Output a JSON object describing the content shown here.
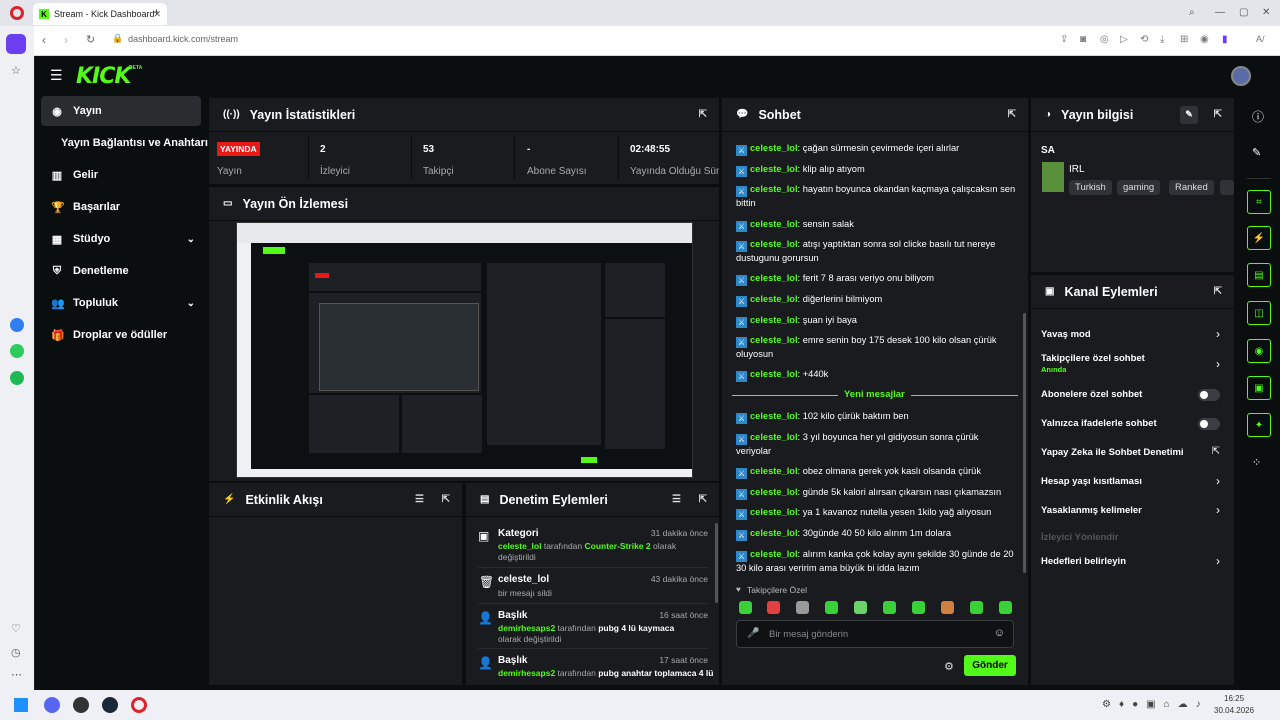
{
  "browser": {
    "tab_title": "Stream - Kick Dashboard",
    "url": "dashboard.kick.com/stream",
    "new_tab": "+"
  },
  "kick": {
    "logo": "KICK",
    "beta": "BETA",
    "accent": "#53fc18"
  },
  "sidebar": {
    "items": [
      {
        "icon": "broadcast-icon",
        "label": "Yayın"
      },
      {
        "icon": "",
        "label": "Yayın Bağlantısı ve Anahtarı"
      },
      {
        "icon": "chart-icon",
        "label": "Gelir"
      },
      {
        "icon": "trophy-icon",
        "label": "Başarılar"
      },
      {
        "icon": "grid-icon",
        "label": "Stüdyo"
      },
      {
        "icon": "shield-icon",
        "label": "Denetleme"
      },
      {
        "icon": "users-icon",
        "label": "Topluluk"
      },
      {
        "icon": "gift-icon",
        "label": "Droplar ve ödüller"
      }
    ]
  },
  "stats": {
    "title": "Yayın İstatistikleri",
    "live_badge": "YAYINDA",
    "live_label": "Yayın",
    "viewers_value": "2",
    "viewers_label": "İzleyici",
    "followers_value": "53",
    "followers_label": "Takipçi",
    "subs_value": "-",
    "subs_label": "Abone Sayısı",
    "uptime_value": "02:48:55",
    "uptime_label": "Yayında Olduğu Süre"
  },
  "preview": {
    "title": "Yayın Ön İzlemesi"
  },
  "activity": {
    "title": "Etkinlik Akışı"
  },
  "modactions": {
    "title": "Denetim Eylemleri",
    "items": [
      {
        "title": "Kategori",
        "time": "31 dakika önce",
        "user": "celeste_lol",
        "by": " tarafından ",
        "target": "Counter-Strike 2",
        "rest": " olarak değiştirildi"
      },
      {
        "title": "celeste_lol",
        "time": "43 dakika önce",
        "line": "bir mesajı sildi"
      },
      {
        "title": "Başlık",
        "time": "16 saat önce",
        "user": "demirhesaps2",
        "by": " tarafından ",
        "target": "pubg 4 lü kaymaca",
        "rest": " olarak değiştirildi"
      },
      {
        "title": "Başlık",
        "time": "17 saat önce",
        "user": "demirhesaps2",
        "by": " tarafından ",
        "target": "pubg anahtar toplamaca 4 lü"
      }
    ]
  },
  "chat": {
    "title": "Sohbet",
    "messages": [
      {
        "user": "celeste_lol",
        "text": ": çağan sürmesin çevirmede içeri alırlar"
      },
      {
        "user": "celeste_lol",
        "text": ": klip alıp atıyom"
      },
      {
        "user": "celeste_lol",
        "text": ": hayatın boyunca okandan kaçmaya çalışcaksın sen bittin"
      },
      {
        "user": "celeste_lol",
        "text": ": sensin salak"
      },
      {
        "user": "celeste_lol",
        "text": ": atışı yaptıktan sonra sol clicke basılı tut nereye dustugunu gorursun"
      },
      {
        "user": "celeste_lol",
        "text": ": ferit 7 8 arası veriyo onu biliyom"
      },
      {
        "user": "celeste_lol",
        "text": ": diğerlerini bilmiyom"
      },
      {
        "user": "celeste_lol",
        "text": ": şuan iyi baya"
      },
      {
        "user": "celeste_lol",
        "text": ": emre senin boy 175 desek 100 kilo olsan çürük oluyosun"
      },
      {
        "user": "celeste_lol",
        "text": ": +440k"
      },
      {
        "user": "celeste_lol",
        "text": ": 102 kilo çürük baktım ben"
      },
      {
        "user": "celeste_lol",
        "text": ": 3 yıl boyunca her yıl gidiyosun sonra çürük veriyolar"
      },
      {
        "user": "celeste_lol",
        "text": ": obez olmana gerek yok kaslı olsanda çürük"
      },
      {
        "user": "celeste_lol",
        "text": ": günde 5k kalori alırsan çıkarsın nası çıkamazsın"
      },
      {
        "user": "celeste_lol",
        "text": ": ya 1 kavanoz nutella yesen 1kilo yağ alıyosun"
      },
      {
        "user": "celeste_lol",
        "text": ": 30günde 40 50 kilo alırım 1m dolara"
      },
      {
        "user": "celeste_lol",
        "text": ": alırım kanka çok kolay aynı şekilde 30 günde de 20 30 kilo arası veririm ama büyük bi idda lazım"
      }
    ],
    "new_messages": "Yeni mesajlar",
    "followers_only": "Takipçilere Özel",
    "input_placeholder": "Bir mesaj gönderin",
    "send": "Gönder"
  },
  "info": {
    "title": "Yayın bilgisi",
    "stream_title": "SA",
    "category": "IRL",
    "tags": [
      "Turkish",
      "gaming",
      "Ranked"
    ]
  },
  "channel_actions": {
    "title": "Kanal Eylemleri",
    "items": [
      {
        "label": "Yavaş mod",
        "kind": "chevron"
      },
      {
        "label": "Takipçilere özel sohbet",
        "sub": "Anında",
        "kind": "chevron"
      },
      {
        "label": "Abonelere özel sohbet",
        "kind": "toggle"
      },
      {
        "label": "Yalnızca ifadelerle sohbet",
        "kind": "toggle"
      },
      {
        "label": "Yapay Zeka ile Sohbet Denetimi",
        "kind": "external"
      },
      {
        "label": "Hesap yaşı kısıtlaması",
        "kind": "chevron"
      },
      {
        "label": "Yasaklanmış kelimeler",
        "kind": "chevron"
      },
      {
        "label": "İzleyici Yönlendir",
        "kind": "disabled"
      },
      {
        "label": "Hedefleri belirleyin",
        "kind": "chevron"
      }
    ]
  },
  "taskbar": {
    "time": "16:25",
    "date": "30.04.2026"
  }
}
